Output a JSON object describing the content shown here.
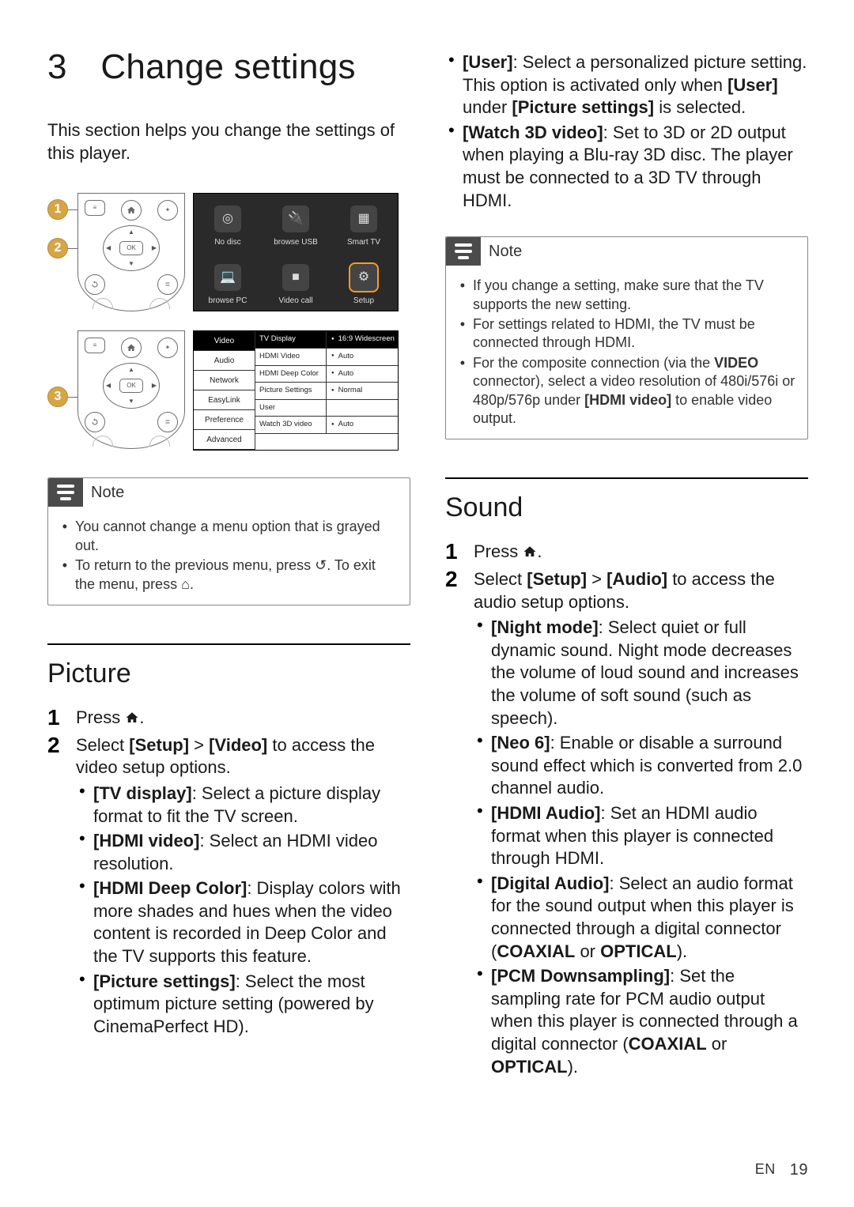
{
  "chapter_number": "3",
  "chapter_title": "Change settings",
  "intro": "This section helps you change the settings of this player.",
  "callouts": {
    "one": "1",
    "two": "2",
    "three": "3"
  },
  "home_tiles": [
    {
      "name": "no-disc",
      "label": "No disc",
      "glyph": "◎"
    },
    {
      "name": "browse-usb",
      "label": "browse USB",
      "glyph": "🔌"
    },
    {
      "name": "smart-tv",
      "label": "Smart TV",
      "glyph": "▦"
    },
    {
      "name": "browse-pc",
      "label": "browse PC",
      "glyph": "💻"
    },
    {
      "name": "video-call",
      "label": "Video call",
      "glyph": "■"
    },
    {
      "name": "setup",
      "label": "Setup",
      "glyph": "⚙"
    }
  ],
  "setup_sidebar": [
    "Video",
    "Audio",
    "Network",
    "EasyLink",
    "Preference",
    "Advanced"
  ],
  "video_rows": [
    {
      "k": "TV Display",
      "v": "16:9 Widescreen"
    },
    {
      "k": "HDMI Video",
      "v": "Auto"
    },
    {
      "k": "HDMI Deep Color",
      "v": "Auto"
    },
    {
      "k": "Picture Settings",
      "v": "Normal"
    },
    {
      "k": "User",
      "v": ""
    },
    {
      "k": "Watch 3D video",
      "v": "Auto"
    }
  ],
  "note_label": "Note",
  "note_left": {
    "items": [
      "You cannot change a menu option that is grayed out.",
      "To return to the previous menu, press ↺. To exit the menu, press ⌂."
    ]
  },
  "picture": {
    "heading": "Picture",
    "step1_pre": "Press ",
    "step2_pre": "Select ",
    "setup": "[Setup]",
    "gt": " > ",
    "video": "[Video]",
    "step2_post": " to access the video setup options.",
    "bullets": [
      {
        "k": "[TV display]",
        "t": ": Select a picture display format to fit the TV screen."
      },
      {
        "k": "[HDMI video]",
        "t": ": Select an HDMI video resolution."
      },
      {
        "k": "[HDMI Deep Color]",
        "t": ": Display colors with more shades and hues when the video content is recorded in Deep Color and the TV supports this feature."
      },
      {
        "k": "[Picture settings]",
        "t": ": Select the most optimum picture setting (powered by CinemaPerfect HD)."
      }
    ]
  },
  "right_bullets": [
    {
      "k": "[User]",
      "t": ": Select a personalized picture setting. This option is activated only when ",
      "k2": "[User]",
      "mid": " under ",
      "k3": "[Picture settings]",
      "post": " is selected."
    },
    {
      "k": "[Watch 3D video]",
      "t": ": Set to 3D or 2D output when playing a Blu-ray 3D disc. The player must be connected to a 3D TV through HDMI."
    }
  ],
  "note_right": {
    "items": [
      {
        "pre": "If you change a setting, make sure that the TV supports the new setting."
      },
      {
        "pre": "For settings related to HDMI, the TV must be connected through HDMI."
      },
      {
        "pre": "For the composite connection (via the ",
        "b": "VIDEO",
        "mid": " connector), select a video resolution of 480i/576i or 480p/576p under ",
        "b2": "[HDMI video]",
        "post": " to enable video output."
      }
    ]
  },
  "sound": {
    "heading": "Sound",
    "step1_pre": "Press ",
    "step2_pre": "Select ",
    "setup": "[Setup]",
    "gt": " > ",
    "audio": "[Audio]",
    "step2_post": " to access the audio setup options.",
    "bullets": [
      {
        "k": "[Night mode]",
        "t": ": Select quiet or full dynamic sound. Night mode decreases the volume of loud sound and increases the volume of soft sound (such as speech)."
      },
      {
        "k": "[Neo 6]",
        "t": ": Enable or disable a surround sound effect which is converted from 2.0 channel audio."
      },
      {
        "k": "[HDMI Audio]",
        "t": ": Set an HDMI audio format when this player is connected through HDMI."
      },
      {
        "k": "[Digital Audio]",
        "t": ": Select an audio format for the sound output when this player is connected through a digital connector (",
        "b": "COAXIAL",
        "mid": "  or ",
        "b2": "OPTICAL",
        "post": ")."
      },
      {
        "k": "[PCM Downsampling]",
        "t": ": Set the sampling rate for PCM audio output when this player is connected through a digital connector (",
        "b": "COAXIAL",
        "mid": "  or ",
        "b2": "OPTICAL",
        "post": ")."
      }
    ]
  },
  "footer": {
    "lang": "EN",
    "page": "19"
  }
}
